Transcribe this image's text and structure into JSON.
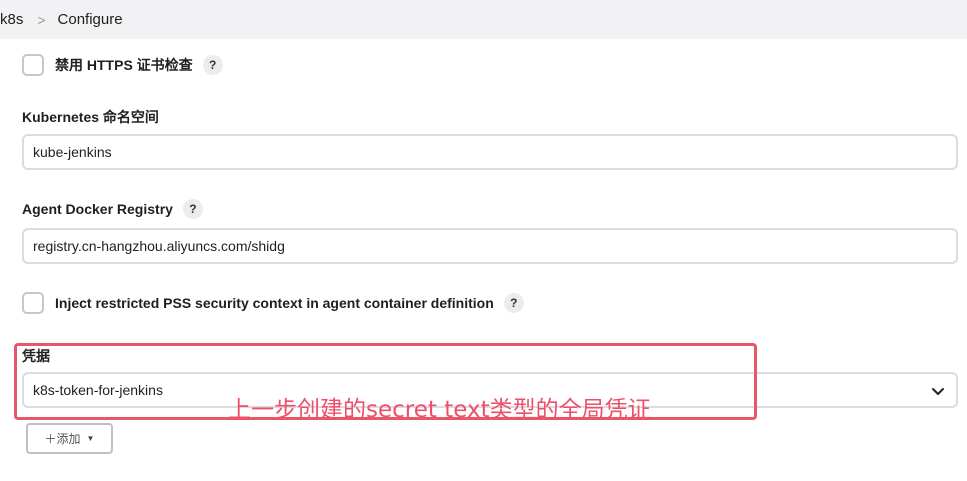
{
  "breadcrumb": {
    "items": [
      "k8s",
      "Configure"
    ],
    "separator": ">"
  },
  "form": {
    "disable_https_check": {
      "label": "禁用 HTTPS 证书检查",
      "checked": false,
      "help": "?"
    },
    "namespace": {
      "label": "Kubernetes 命名空间",
      "value": "kube-jenkins"
    },
    "agent_registry": {
      "label": "Agent Docker Registry",
      "help": "?",
      "value": "registry.cn-hangzhou.aliyuncs.com/shidg"
    },
    "inject_pss": {
      "label": "Inject restricted PSS security context in agent container definition",
      "checked": false,
      "help": "?"
    },
    "credentials": {
      "label": "凭据",
      "selected": "k8s-token-for-jenkins",
      "add_button": "＋添加",
      "add_caret": "▼"
    }
  },
  "annotation": {
    "text": "上一步创建的secret text类型的全局凭证",
    "color": "#ee4f6b"
  },
  "icons": {
    "help": "question-mark",
    "select": "chevron-down"
  }
}
